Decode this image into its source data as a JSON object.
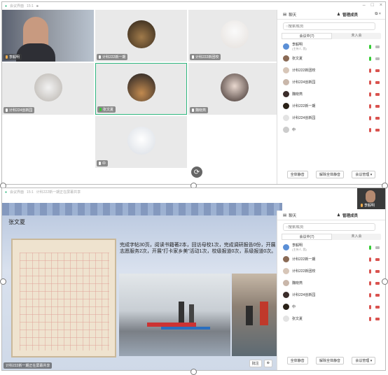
{
  "top": {
    "title_bar": {
      "app": "会议界面",
      "time": "15:1",
      "grid": "■"
    },
    "tiles": [
      {
        "name": "李毅明",
        "mic": "on"
      },
      {
        "name": "计科222新一期",
        "mic": "on"
      },
      {
        "name": "计科222新团校",
        "mic": "on"
      },
      {
        "name": "计科224创新园",
        "mic": "on"
      },
      {
        "name": "张文夏",
        "mic": "on"
      },
      {
        "name": "魏晓燕",
        "mic": "on"
      },
      {
        "name": "中",
        "mic": "on"
      }
    ],
    "panel": {
      "tab_chat": "聊天",
      "tab_members": "管理成员",
      "search_placeholder": "搜索成员",
      "sub_in": "会议中(7)",
      "sub_out": "未入会",
      "members": [
        {
          "name": "李毅明",
          "sub": "(主持人, 我)",
          "mic": "on",
          "cam": "on"
        },
        {
          "name": "张文夏",
          "mic": "on",
          "cam": "on"
        },
        {
          "name": "计科222新团校",
          "mic": "off",
          "cam": "off"
        },
        {
          "name": "计科224创新园",
          "mic": "off",
          "cam": "off"
        },
        {
          "name": "魏晓燕",
          "mic": "off",
          "cam": "off"
        },
        {
          "name": "计科222新一期",
          "mic": "off",
          "cam": "off"
        },
        {
          "name": "计科224创新园",
          "mic": "off",
          "cam": "off"
        },
        {
          "name": "中",
          "mic": "off",
          "cam": "off"
        }
      ],
      "btn_mute_all": "全体静音",
      "btn_unmute_all": "解除全体静音",
      "btn_manage": "会议管理 ▾"
    }
  },
  "bottom": {
    "title_bar": {
      "app": "会议界面",
      "time": "15:1",
      "share": "计科222新一期正在屏幕共享"
    },
    "self_cam": "李毅明",
    "slide": {
      "heading": "张文夏",
      "text": "完成字帖30页，阅读书籍著2本，回访母校1次，完成调研报告0份，开展志愿服务2次，开展“打卡家乡美”活动1次，校级报道0次，系级报道0次。",
      "annotate": "批注",
      "zoom": "⊕"
    },
    "share_label": "计科222新一期正在屏幕共享",
    "panel": {
      "tab_chat": "聊天",
      "tab_members": "管理成员",
      "search_placeholder": "搜索成员",
      "sub_in": "会议中(7)",
      "sub_out": "未入会",
      "members": [
        {
          "name": "李毅明",
          "sub": "(主持人, 我)",
          "mic": "on",
          "cam": "on"
        },
        {
          "name": "计科222新一期",
          "mic": "off",
          "cam": "off"
        },
        {
          "name": "计科222新团校",
          "mic": "off",
          "cam": "off"
        },
        {
          "name": "魏晓燕",
          "mic": "off",
          "cam": "off"
        },
        {
          "name": "计科224创新园",
          "mic": "off",
          "cam": "off"
        },
        {
          "name": "中",
          "mic": "off",
          "cam": "off"
        },
        {
          "name": "张文夏",
          "mic": "off",
          "cam": "off"
        }
      ],
      "btn_mute_all": "全体静音",
      "btn_unmute_all": "解除全体静音",
      "btn_manage": "会议管理 ▾"
    }
  },
  "colors": {
    "accent": "#2fb77f",
    "mic_on": "#33cc33",
    "muted": "#d9534f"
  }
}
